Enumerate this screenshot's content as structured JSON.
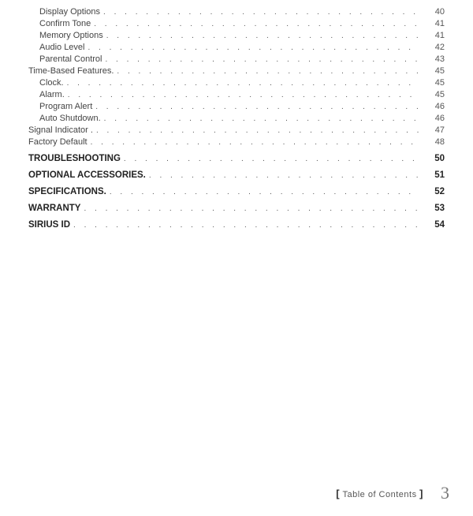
{
  "toc": {
    "rows": [
      {
        "title": "Display Options",
        "page": "40",
        "indent": 2,
        "bold": false
      },
      {
        "title": "Confirm Tone",
        "page": "41",
        "indent": 2,
        "bold": false
      },
      {
        "title": "Memory Options",
        "page": "41",
        "indent": 2,
        "bold": false
      },
      {
        "title": "Audio Level",
        "page": "42",
        "indent": 2,
        "bold": false
      },
      {
        "title": "Parental Control",
        "page": "43",
        "indent": 2,
        "bold": false
      },
      {
        "title": "Time-Based Features.",
        "page": "45",
        "indent": 1,
        "bold": false
      },
      {
        "title": "Clock.",
        "page": "45",
        "indent": 2,
        "bold": false
      },
      {
        "title": "Alarm.",
        "page": "45",
        "indent": 2,
        "bold": false
      },
      {
        "title": "Program Alert",
        "page": "46",
        "indent": 2,
        "bold": false
      },
      {
        "title": "Auto Shutdown.",
        "page": "46",
        "indent": 2,
        "bold": false
      },
      {
        "title": "Signal Indicator .",
        "page": "47",
        "indent": 1,
        "bold": false
      },
      {
        "title": "Factory Default",
        "page": "48",
        "indent": 1,
        "bold": false
      },
      {
        "title": "TROUBLESHOOTING",
        "page": "50",
        "indent": 0,
        "bold": true
      },
      {
        "title": "OPTIONAL ACCESSORIES.",
        "page": "51",
        "indent": 0,
        "bold": true
      },
      {
        "title": "SPECIFICATIONS.",
        "page": "52",
        "indent": 0,
        "bold": true
      },
      {
        "title": "WARRANTY",
        "page": "53",
        "indent": 0,
        "bold": true
      },
      {
        "title": "SIRIUS ID",
        "page": "54",
        "indent": 0,
        "bold": true
      }
    ]
  },
  "footer": {
    "label": "Table of Contents",
    "page_number": "3"
  }
}
